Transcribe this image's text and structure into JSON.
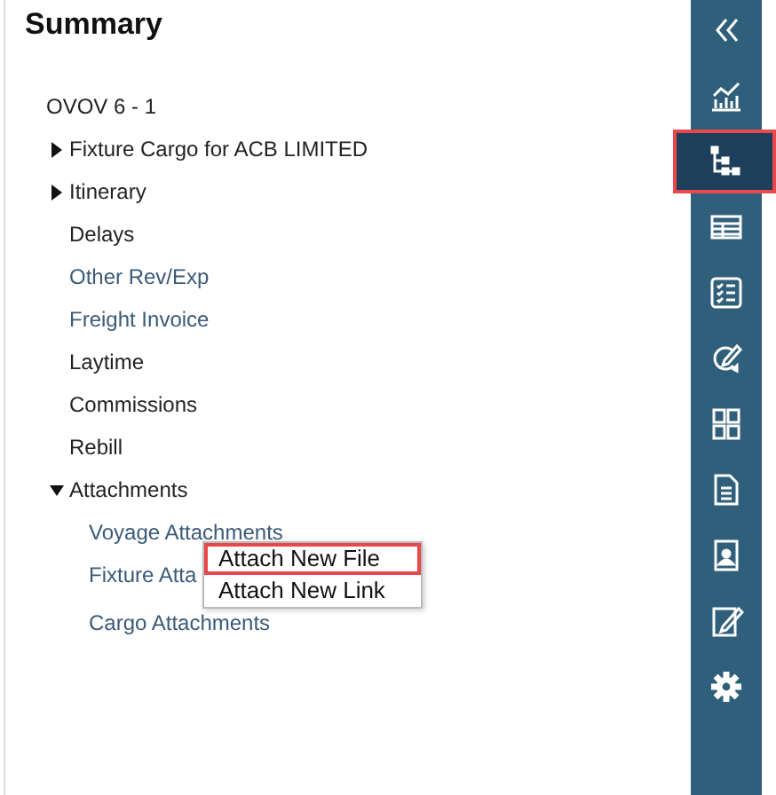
{
  "summary": {
    "title": "Summary",
    "tree": [
      {
        "label": "OVOV 6 - 1",
        "kind": "text",
        "children": [
          {
            "label": "Fixture Cargo for ACB LIMITED",
            "kind": "text",
            "expanded": false
          },
          {
            "label": "Itinerary",
            "kind": "text",
            "expanded": false
          },
          {
            "label": "Delays",
            "kind": "text"
          },
          {
            "label": "Other Rev/Exp",
            "kind": "link"
          },
          {
            "label": "Freight Invoice",
            "kind": "link"
          },
          {
            "label": "Laytime",
            "kind": "text"
          },
          {
            "label": "Commissions",
            "kind": "text"
          },
          {
            "label": "Rebill",
            "kind": "text"
          },
          {
            "label": "Attachments",
            "kind": "text",
            "expanded": true,
            "children": [
              {
                "label": "Voyage Attachments",
                "kind": "link"
              },
              {
                "label": "Fixture Atta",
                "kind": "link"
              },
              {
                "label": "Cargo Attachments",
                "kind": "link"
              }
            ]
          }
        ]
      }
    ]
  },
  "context_menu": [
    {
      "label": "Attach New File",
      "selected": true
    },
    {
      "label": "Attach New Link",
      "selected": false
    }
  ],
  "sidebar": {
    "items": [
      {
        "kind": "collapse",
        "selected": false
      },
      {
        "kind": "chart",
        "selected": false
      },
      {
        "kind": "tree",
        "selected": true
      },
      {
        "kind": "table",
        "selected": false
      },
      {
        "kind": "checklist",
        "selected": false
      },
      {
        "kind": "refresh",
        "selected": false
      },
      {
        "kind": "grid",
        "selected": false
      },
      {
        "kind": "document",
        "selected": false
      },
      {
        "kind": "contact",
        "selected": false
      },
      {
        "kind": "notes",
        "selected": false
      },
      {
        "kind": "settings",
        "selected": false
      }
    ]
  }
}
